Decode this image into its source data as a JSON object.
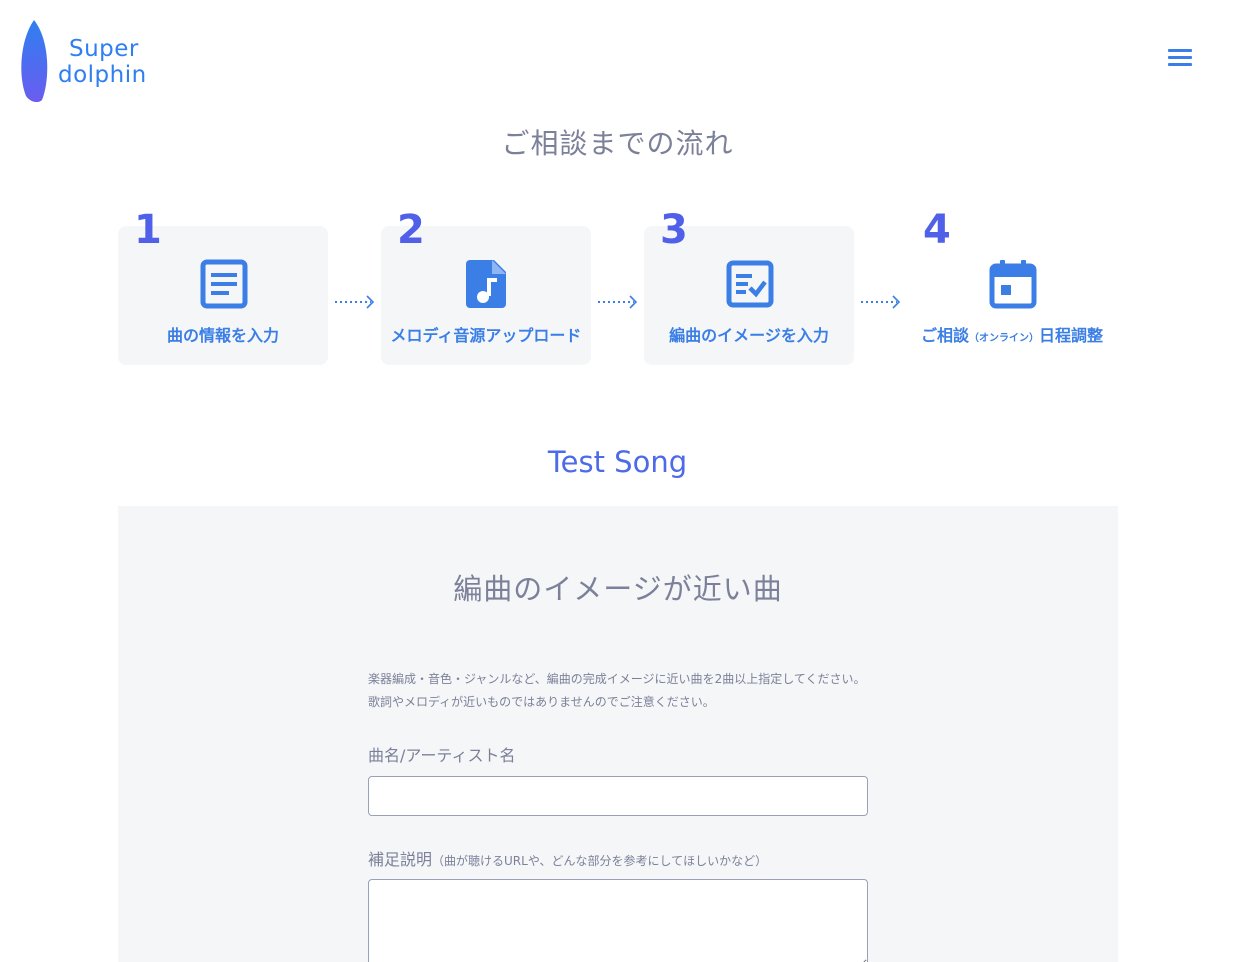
{
  "logo": {
    "line1": "Super",
    "line2": "dolphin",
    "color": "#2f7ff0"
  },
  "header": {
    "menu_icon": "hamburger-menu-icon"
  },
  "flow": {
    "title": "ご相談までの流れ",
    "steps": [
      {
        "number": "1",
        "label": "曲の情報を入力",
        "icon": "document-icon"
      },
      {
        "number": "2",
        "label": "メロディ音源アップロード",
        "icon": "music-file-icon"
      },
      {
        "number": "3",
        "label": "編曲のイメージを入力",
        "icon": "checklist-icon"
      },
      {
        "number": "4",
        "label_pre": "ご相談",
        "label_small": "（オンライン）",
        "label_post": "日程調整",
        "icon": "calendar-icon"
      }
    ]
  },
  "song": {
    "title": "Test Song"
  },
  "form": {
    "section_title": "編曲のイメージが近い曲",
    "description_line1": "楽器編成・音色・ジャンルなど、編曲の完成イメージに近い曲を2曲以上指定してください。",
    "description_line2": "歌詞やメロディが近いものではありませんのでご注意ください。",
    "song_field_label": "曲名/アーティスト名",
    "song_field_value": "",
    "note_field_label": "補足説明",
    "note_field_hint": "（曲が聴けるURLや、どんな部分を参考にしてほしいかなど）",
    "note_field_value": ""
  },
  "colors": {
    "accent": "#3b7fe6",
    "number": "#5060e8",
    "text": "#7c8199",
    "panel": "#f5f6f8"
  }
}
